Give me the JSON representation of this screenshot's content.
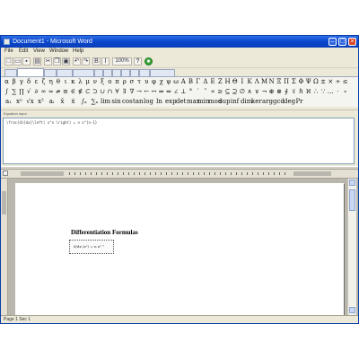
{
  "window": {
    "title": "Document1 - Microsoft Word"
  },
  "menubar": {
    "items": [
      "File",
      "Edit",
      "View",
      "Window",
      "Help"
    ]
  },
  "toolbar": {
    "buttons": [
      {
        "name": "new-file-icon",
        "glyph": "□"
      },
      {
        "name": "open-folder-icon",
        "glyph": "▭"
      },
      {
        "name": "save-icon",
        "glyph": "▪"
      },
      {
        "name": "print-icon",
        "glyph": "▤"
      },
      {
        "name": "cut-icon",
        "glyph": "✂"
      },
      {
        "name": "copy-icon",
        "glyph": "❐"
      },
      {
        "name": "paste-icon",
        "glyph": "▣"
      },
      {
        "name": "undo-icon",
        "glyph": "↶"
      },
      {
        "name": "redo-icon",
        "glyph": "↷"
      },
      {
        "name": "bold-icon",
        "glyph": "B"
      },
      {
        "name": "italic-icon",
        "glyph": "I"
      },
      {
        "name": "zoom-select",
        "glyph": "100%"
      },
      {
        "name": "help-icon",
        "glyph": "?"
      },
      {
        "name": "insert-equation-icon",
        "glyph": "●"
      }
    ]
  },
  "tabs": [
    "",
    "",
    "",
    "",
    "",
    "",
    "",
    "",
    "",
    "",
    "",
    ""
  ],
  "palette": {
    "row1": [
      "α",
      "β",
      "γ",
      "δ",
      "ε",
      "ζ",
      "η",
      "θ",
      "ι",
      "κ",
      "λ",
      "μ",
      "ν",
      "ξ",
      "ο",
      "π",
      "ρ",
      "σ",
      "τ",
      "υ",
      "φ",
      "χ",
      "ψ",
      "ω",
      "Α",
      "Β",
      "Γ",
      "Δ",
      "Ε",
      "Ζ",
      "Η",
      "Θ",
      "Ι",
      "Κ",
      "Λ",
      "Μ",
      "Ν",
      "Ξ",
      "Π",
      "Σ",
      "Φ",
      "Ψ",
      "Ω",
      "±",
      "×",
      "÷",
      "≤"
    ],
    "row2": [
      "∫",
      "∑",
      "∏",
      "√",
      "∂",
      "∞",
      "≈",
      "≠",
      "≡",
      "∈",
      "∉",
      "⊂",
      "⊃",
      "∪",
      "∩",
      "∀",
      "∃",
      "∇",
      "→",
      "←",
      "↔",
      "⇒",
      "⇔",
      "∠",
      "⊥",
      "°",
      "′",
      "″",
      "∝",
      "≥",
      "⊆",
      "⊇",
      "∅",
      "∧",
      "∨",
      "¬",
      "⊕",
      "⊗",
      "∮",
      "ℓ",
      "ℏ",
      "ℵ",
      "∴",
      "∵",
      "…",
      "⋅",
      "∘"
    ],
    "row3": [
      "a₁",
      "xⁿ",
      "√x",
      "x²",
      "aᵢ",
      "x̄",
      "ẋ",
      "∫ₐ",
      "∑ₙ",
      "lim",
      "sin",
      "cos",
      "tan",
      "log",
      "ln",
      "exp",
      "det",
      "max",
      "min",
      "mod",
      "sup",
      "inf",
      "dim",
      "ker",
      "arg",
      "gcd",
      "deg",
      "Pr"
    ]
  },
  "input_panel": {
    "label": "Equation input",
    "code": "\\frac{d}{dx}\\left( x^n \\right) = n x^{n-1}"
  },
  "document": {
    "heading": "Differentiation Formulas",
    "equation_preview": "d/dx (xⁿ) = n xⁿ⁻¹"
  },
  "statusbar": {
    "text": "Page 1   Sec 1"
  }
}
